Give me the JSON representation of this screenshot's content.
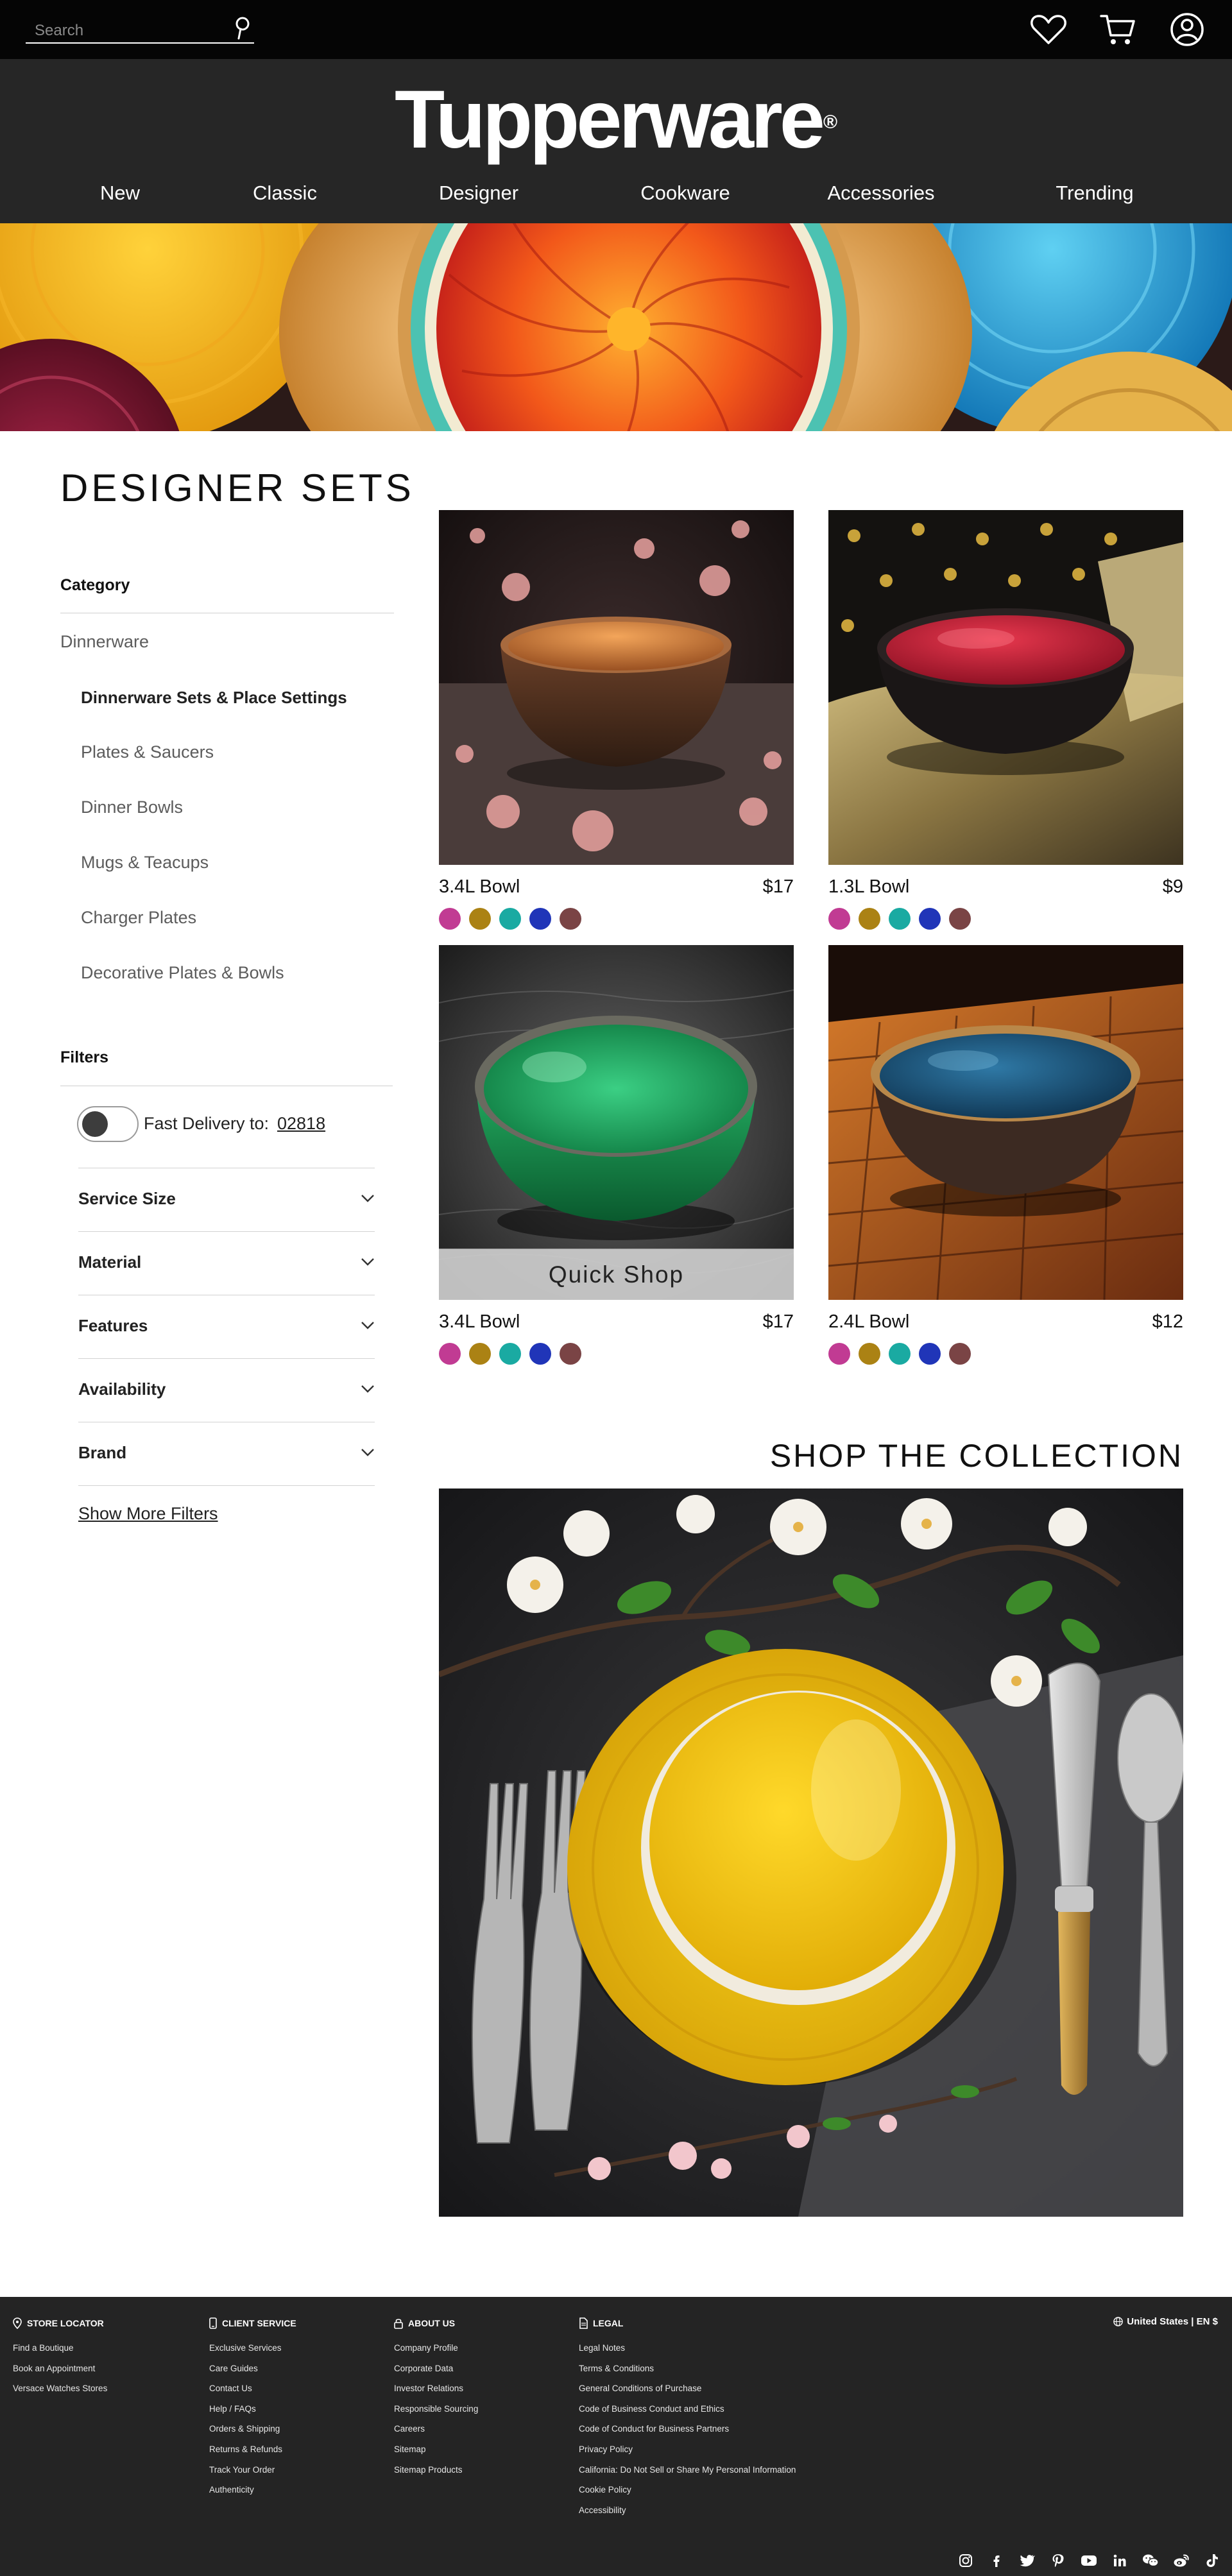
{
  "search": {
    "placeholder": "Search"
  },
  "brand": {
    "name": "Tupperware",
    "mark": "®"
  },
  "nav": [
    {
      "label": "New"
    },
    {
      "label": "Classic"
    },
    {
      "label": "Designer"
    },
    {
      "label": "Cookware"
    },
    {
      "label": "Accessories"
    },
    {
      "label": "Trending"
    }
  ],
  "page": {
    "title": "DESIGNER SETS"
  },
  "sidebar": {
    "category_heading": "Category",
    "category_root": "Dinnerware",
    "subcategories": [
      "Dinnerware Sets & Place Settings",
      "Plates & Saucers",
      "Dinner Bowls",
      "Mugs & Teacups",
      "Charger Plates",
      "Decorative Plates & Bowls"
    ],
    "filters_heading": "Filters",
    "fast_delivery_label": "Fast Delivery to:",
    "zip": "02818",
    "fast_delivery_enabled": false,
    "filters": [
      "Service Size",
      "Material",
      "Features",
      "Availability",
      "Brand"
    ],
    "show_more": "Show More Filters"
  },
  "products": [
    {
      "name": "3.4L Bowl",
      "price": "$17",
      "quick_shop": ""
    },
    {
      "name": "1.3L Bowl",
      "price": "$9",
      "quick_shop": ""
    },
    {
      "name": "3.4L Bowl",
      "price": "$17",
      "quick_shop": "Quick Shop"
    },
    {
      "name": "2.4L Bowl",
      "price": "$12",
      "quick_shop": ""
    }
  ],
  "swatch_colors": [
    "#c13b93",
    "#ab8214",
    "#1aaaa2",
    "#2035b8",
    "#7a4445"
  ],
  "collection": {
    "title": "SHOP THE COLLECTION"
  },
  "footer": {
    "columns": [
      {
        "heading": "STORE LOCATOR",
        "icon": "map-pin-icon",
        "links": [
          "Find a Boutique",
          "Book an Appointment",
          "Versace Watches Stores"
        ]
      },
      {
        "heading": "CLIENT SERVICE",
        "icon": "phone-icon",
        "links": [
          "Exclusive Services",
          "Care Guides",
          "Contact Us",
          "Help / FAQs",
          "Orders & Shipping",
          "Returns & Refunds",
          "Track Your Order",
          "Authenticity"
        ]
      },
      {
        "heading": "ABOUT US",
        "icon": "lock-icon",
        "links": [
          "Company Profile",
          "Corporate Data",
          "Investor Relations",
          "Responsible Sourcing",
          "Careers",
          "Sitemap",
          "Sitemap Products"
        ]
      },
      {
        "heading": "LEGAL",
        "icon": "document-icon",
        "links": [
          "Legal Notes",
          "Terms & Conditions",
          "General Conditions of Purchase",
          "Code of Business Conduct and Ethics",
          "Code of Conduct for Business Partners",
          "Privacy Policy",
          "California: Do Not Sell or Share My Personal Information",
          "Cookie Policy",
          "Accessibility"
        ]
      }
    ],
    "locale": "United States | EN $",
    "socials": [
      "instagram-icon",
      "facebook-icon",
      "twitter-icon",
      "pinterest-icon",
      "youtube-icon",
      "linkedin-icon",
      "wechat-icon",
      "weibo-icon",
      "tiktok-icon"
    ]
  },
  "colors": {
    "topbar": "#050505",
    "header": "#262626",
    "footer": "#242424"
  }
}
